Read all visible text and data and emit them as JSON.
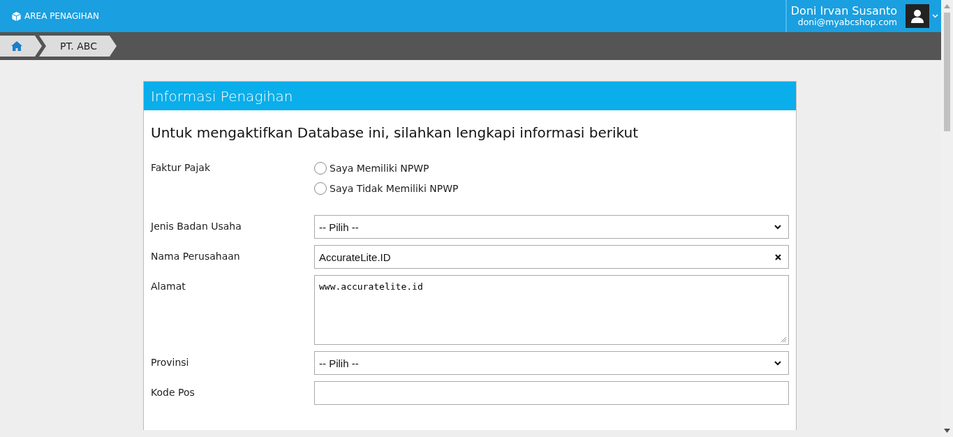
{
  "header": {
    "app_title": "AREA PENAGIHAN",
    "user_name": "Doni Irvan Susanto",
    "user_email": "doni@myabcshop.com"
  },
  "breadcrumb": {
    "items": [
      "PT. ABC"
    ]
  },
  "card": {
    "title": "Informasi Penagihan",
    "intro": "Untuk mengaktifkan Database ini, silahkan lengkapi informasi berikut",
    "fields": [
      {
        "kind": "radio",
        "label": "Faktur Pajak",
        "options": [
          {
            "label": "Saya Memiliki NPWP",
            "selected": false
          },
          {
            "label": "Saya Tidak Memiliki NPWP",
            "selected": false
          }
        ]
      },
      {
        "kind": "select",
        "label": "Jenis Badan Usaha",
        "value": "-- Pilih --"
      },
      {
        "kind": "text",
        "label": "Nama Perusahaan",
        "value": "AccurateLite.ID",
        "clearable": true
      },
      {
        "kind": "textarea",
        "label": "Alamat",
        "value": "www.accuratelite.id"
      },
      {
        "kind": "select",
        "label": "Provinsi",
        "value": "-- Pilih --"
      },
      {
        "kind": "text",
        "label": "Kode Pos",
        "clearable": false
      }
    ]
  }
}
